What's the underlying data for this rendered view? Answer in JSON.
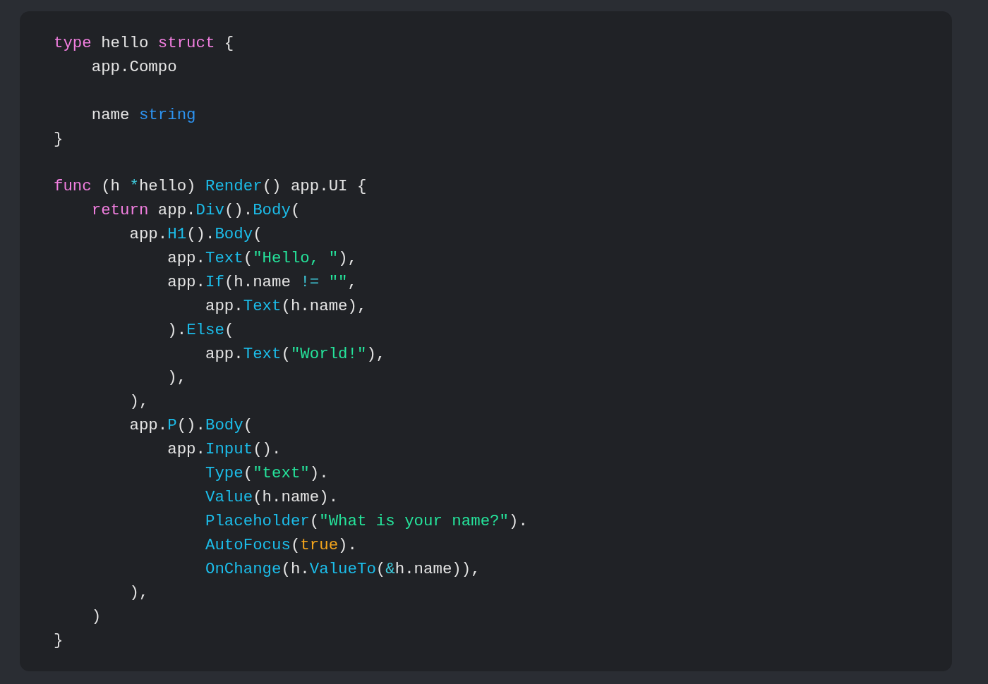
{
  "code_lines": [
    {
      "kind": "code",
      "tokens": [
        {
          "text": "type",
          "kind": "keyword"
        },
        {
          "text": " hello ",
          "kind": "plain"
        },
        {
          "text": "struct",
          "kind": "keyword"
        },
        {
          "text": " {",
          "kind": "plain"
        }
      ]
    },
    {
      "kind": "code",
      "tokens": [
        {
          "text": "    app.Compo",
          "kind": "plain"
        }
      ]
    },
    {
      "kind": "blank"
    },
    {
      "kind": "code",
      "tokens": [
        {
          "text": "    name ",
          "kind": "plain"
        },
        {
          "text": "string",
          "kind": "type"
        }
      ]
    },
    {
      "kind": "code",
      "tokens": [
        {
          "text": "}",
          "kind": "plain"
        }
      ]
    },
    {
      "kind": "blank"
    },
    {
      "kind": "code",
      "tokens": [
        {
          "text": "func",
          "kind": "keyword"
        },
        {
          "text": " (h ",
          "kind": "plain"
        },
        {
          "text": "*",
          "kind": "operator"
        },
        {
          "text": "hello) ",
          "kind": "plain"
        },
        {
          "text": "Render",
          "kind": "function"
        },
        {
          "text": "() app.UI {",
          "kind": "plain"
        }
      ]
    },
    {
      "kind": "code",
      "tokens": [
        {
          "text": "    return",
          "kind": "keyword"
        },
        {
          "text": " app.",
          "kind": "plain"
        },
        {
          "text": "Div",
          "kind": "function"
        },
        {
          "text": "().",
          "kind": "plain"
        },
        {
          "text": "Body",
          "kind": "function"
        },
        {
          "text": "(",
          "kind": "plain"
        }
      ]
    },
    {
      "kind": "code",
      "tokens": [
        {
          "text": "        app.",
          "kind": "plain"
        },
        {
          "text": "H1",
          "kind": "function"
        },
        {
          "text": "().",
          "kind": "plain"
        },
        {
          "text": "Body",
          "kind": "function"
        },
        {
          "text": "(",
          "kind": "plain"
        }
      ]
    },
    {
      "kind": "code",
      "tokens": [
        {
          "text": "            app.",
          "kind": "plain"
        },
        {
          "text": "Text",
          "kind": "function"
        },
        {
          "text": "(",
          "kind": "plain"
        },
        {
          "text": "\"Hello, \"",
          "kind": "string"
        },
        {
          "text": "),",
          "kind": "plain"
        }
      ]
    },
    {
      "kind": "code",
      "tokens": [
        {
          "text": "            app.",
          "kind": "plain"
        },
        {
          "text": "If",
          "kind": "function"
        },
        {
          "text": "(h.name ",
          "kind": "plain"
        },
        {
          "text": "!= ",
          "kind": "operator"
        },
        {
          "text": "\"\"",
          "kind": "string"
        },
        {
          "text": ",",
          "kind": "plain"
        }
      ]
    },
    {
      "kind": "code",
      "tokens": [
        {
          "text": "                app.",
          "kind": "plain"
        },
        {
          "text": "Text",
          "kind": "function"
        },
        {
          "text": "(h.name),",
          "kind": "plain"
        }
      ]
    },
    {
      "kind": "code",
      "tokens": [
        {
          "text": "            ).",
          "kind": "plain"
        },
        {
          "text": "Else",
          "kind": "function"
        },
        {
          "text": "(",
          "kind": "plain"
        }
      ]
    },
    {
      "kind": "code",
      "tokens": [
        {
          "text": "                app.",
          "kind": "plain"
        },
        {
          "text": "Text",
          "kind": "function"
        },
        {
          "text": "(",
          "kind": "plain"
        },
        {
          "text": "\"World!\"",
          "kind": "string"
        },
        {
          "text": "),",
          "kind": "plain"
        }
      ]
    },
    {
      "kind": "code",
      "tokens": [
        {
          "text": "            ),",
          "kind": "plain"
        }
      ]
    },
    {
      "kind": "code",
      "tokens": [
        {
          "text": "        ),",
          "kind": "plain"
        }
      ]
    },
    {
      "kind": "code",
      "tokens": [
        {
          "text": "        app.",
          "kind": "plain"
        },
        {
          "text": "P",
          "kind": "function"
        },
        {
          "text": "().",
          "kind": "plain"
        },
        {
          "text": "Body",
          "kind": "function"
        },
        {
          "text": "(",
          "kind": "plain"
        }
      ]
    },
    {
      "kind": "code",
      "tokens": [
        {
          "text": "            app.",
          "kind": "plain"
        },
        {
          "text": "Input",
          "kind": "function"
        },
        {
          "text": "().",
          "kind": "plain"
        }
      ]
    },
    {
      "kind": "code",
      "tokens": [
        {
          "text": "                Type",
          "kind": "function"
        },
        {
          "text": "(",
          "kind": "plain"
        },
        {
          "text": "\"text\"",
          "kind": "string"
        },
        {
          "text": ").",
          "kind": "plain"
        }
      ]
    },
    {
      "kind": "code",
      "tokens": [
        {
          "text": "                Value",
          "kind": "function"
        },
        {
          "text": "(h.name).",
          "kind": "plain"
        }
      ]
    },
    {
      "kind": "code",
      "tokens": [
        {
          "text": "                Placeholder",
          "kind": "function"
        },
        {
          "text": "(",
          "kind": "plain"
        },
        {
          "text": "\"What is your name?\"",
          "kind": "string"
        },
        {
          "text": ").",
          "kind": "plain"
        }
      ]
    },
    {
      "kind": "code",
      "tokens": [
        {
          "text": "                AutoFocus",
          "kind": "function"
        },
        {
          "text": "(",
          "kind": "plain"
        },
        {
          "text": "true",
          "kind": "boolean"
        },
        {
          "text": ").",
          "kind": "plain"
        }
      ]
    },
    {
      "kind": "code",
      "tokens": [
        {
          "text": "                OnChange",
          "kind": "function"
        },
        {
          "text": "(h.",
          "kind": "plain"
        },
        {
          "text": "ValueTo",
          "kind": "function"
        },
        {
          "text": "(",
          "kind": "plain"
        },
        {
          "text": "&",
          "kind": "operator"
        },
        {
          "text": "h.name)),",
          "kind": "plain"
        }
      ]
    },
    {
      "kind": "code",
      "tokens": [
        {
          "text": "        ),",
          "kind": "plain"
        }
      ]
    },
    {
      "kind": "code",
      "tokens": [
        {
          "text": "    )",
          "kind": "plain"
        }
      ]
    },
    {
      "kind": "code",
      "tokens": [
        {
          "text": "}",
          "kind": "plain"
        }
      ]
    }
  ]
}
